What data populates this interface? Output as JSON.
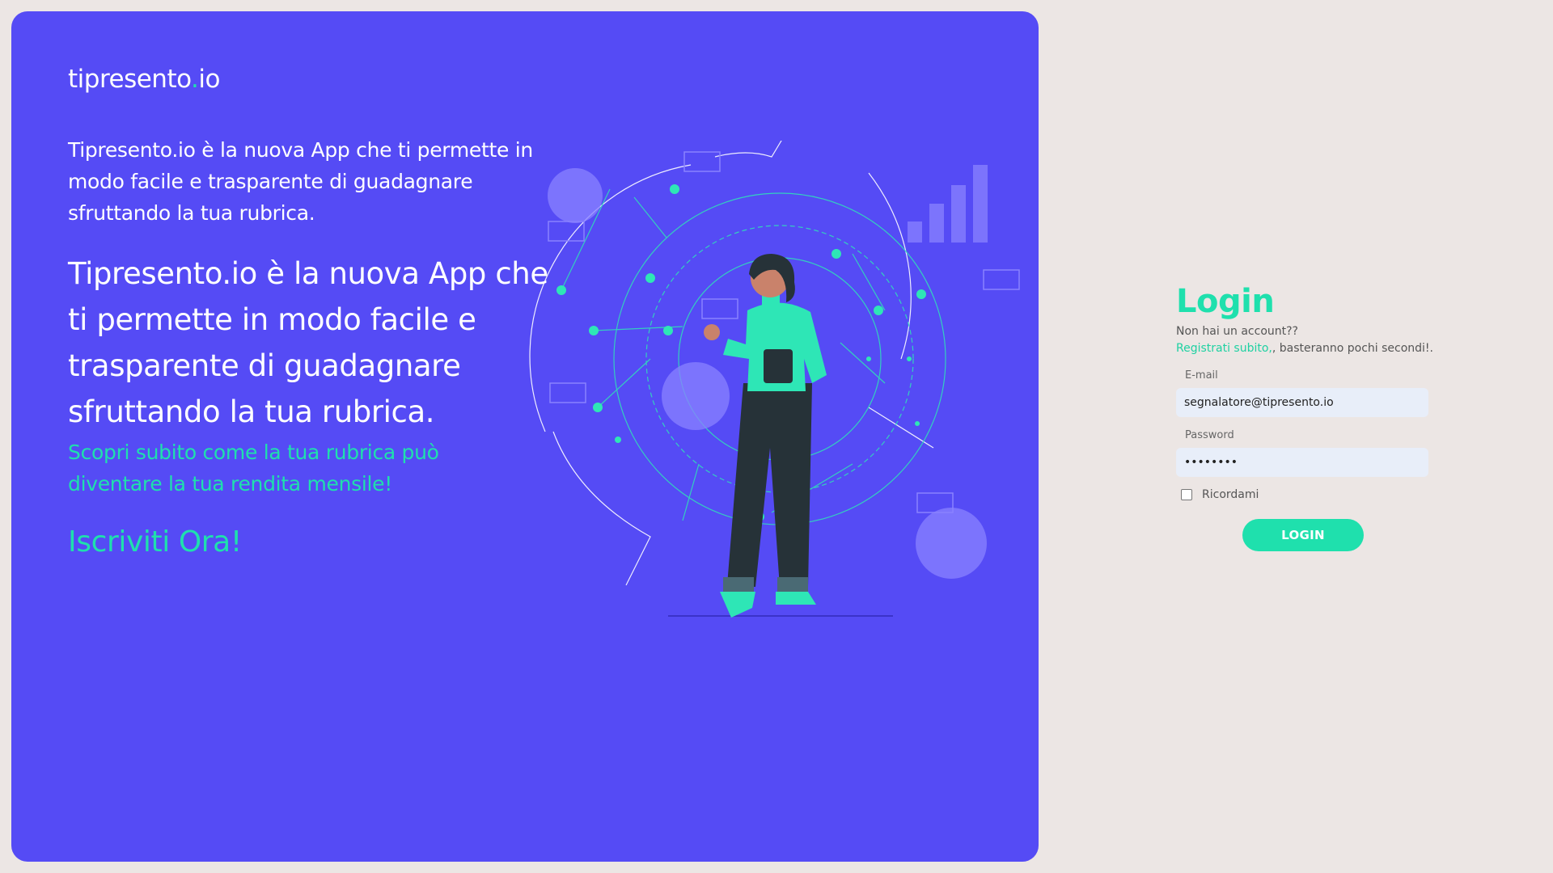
{
  "hero": {
    "logo_text": "tipresento",
    "logo_dot": ".",
    "logo_tld": "io",
    "intro_small": "Tipresento.io è la nuova App che ti permette in modo facile e trasparente di guadagnare sfruttando la tua rubrica.",
    "intro_big": "Tipresento.io è la nuova App che ti permette in modo facile e trasparente di guadagnare sfruttando la tua rubrica.",
    "discover": "Scopri subito come la tua rubrica può diventare la tua rendita mensile!",
    "cta": "Iscriviti Ora!",
    "colors": {
      "background": "#554bf5",
      "accent": "#1fe0ad",
      "page_background": "#ece6e4"
    }
  },
  "login": {
    "title": "Login",
    "no_account": "Non hai un account??",
    "register_link": "Registrati subito,",
    "register_rest": ", basteranno pochi secondi!.",
    "email_label": "E-mail",
    "email_value": "segnalatore@tipresento.io",
    "password_label": "Password",
    "password_value": "password",
    "remember_label": "Ricordami",
    "remember_checked": false,
    "button_label": "LOGIN"
  }
}
